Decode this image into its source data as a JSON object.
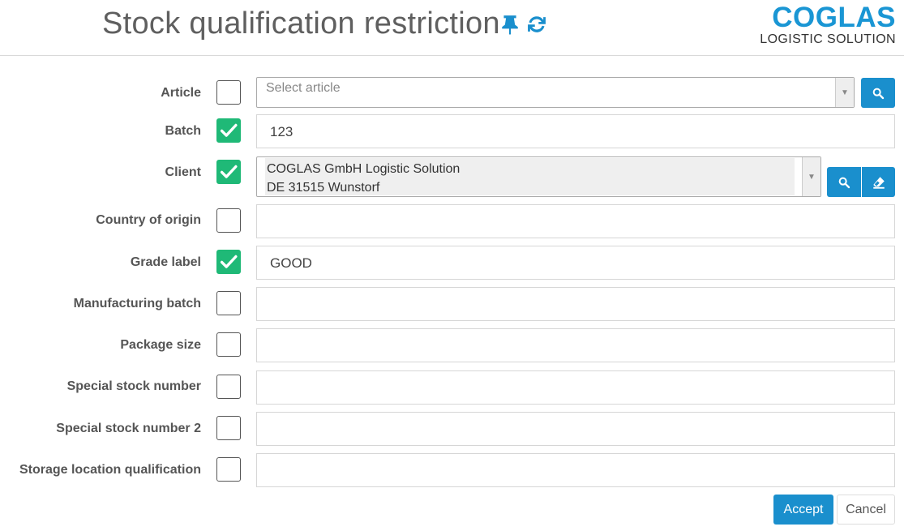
{
  "header": {
    "title": "Stock qualification restriction",
    "logo_main": "COGLAS",
    "logo_sub": "LOGISTIC SOLUTION"
  },
  "fields": {
    "article": {
      "label": "Article",
      "checked": false,
      "placeholder": "Select article"
    },
    "batch": {
      "label": "Batch",
      "checked": true,
      "value": "123"
    },
    "client": {
      "label": "Client",
      "checked": true,
      "line1": "COGLAS GmbH Logistic Solution",
      "line2": "DE 31515 Wunstorf"
    },
    "country_of_origin": {
      "label": "Country of origin",
      "checked": false,
      "value": ""
    },
    "grade_label": {
      "label": "Grade label",
      "checked": true,
      "value": "GOOD"
    },
    "manufacturing_batch": {
      "label": "Manufacturing batch",
      "checked": false,
      "value": ""
    },
    "package_size": {
      "label": "Package size",
      "checked": false,
      "value": ""
    },
    "special_stock_number": {
      "label": "Special stock number",
      "checked": false,
      "value": ""
    },
    "special_stock_number_2": {
      "label": "Special stock number 2",
      "checked": false,
      "value": ""
    },
    "storage_location_qualification": {
      "label": "Storage location qualification",
      "checked": false,
      "value": ""
    }
  },
  "actions": {
    "accept_label": "Accept",
    "cancel_label": "Cancel"
  },
  "colors": {
    "accent": "#1a8fcd",
    "check": "#1fb977",
    "logo": "#1a96d4"
  },
  "icons": {
    "pin": "pin-icon",
    "refresh": "refresh-icon",
    "search": "search-icon",
    "eraser": "eraser-icon",
    "check": "check-icon",
    "dropdown": "dropdown-arrow-icon"
  }
}
